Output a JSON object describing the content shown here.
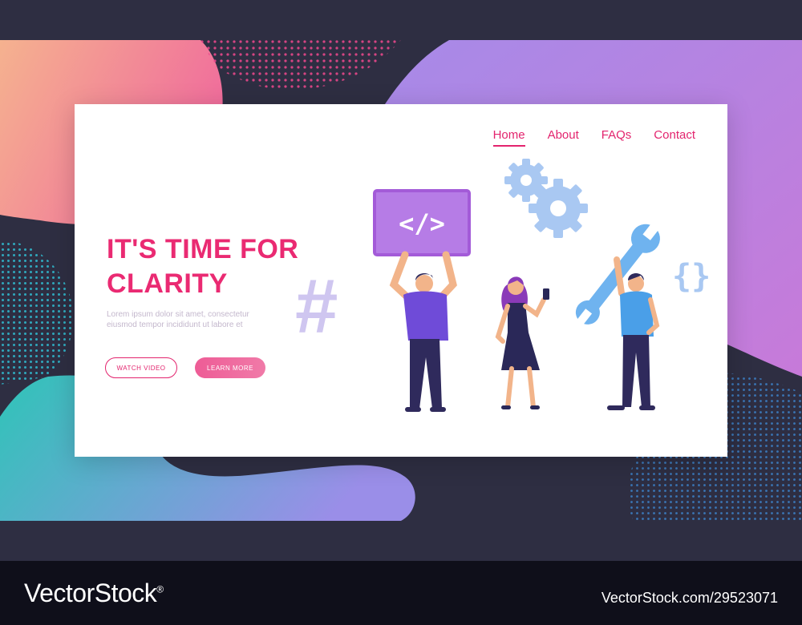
{
  "nav": {
    "items": [
      {
        "label": "Home",
        "active": true
      },
      {
        "label": "About",
        "active": false
      },
      {
        "label": "FAQs",
        "active": false
      },
      {
        "label": "Contact",
        "active": false
      }
    ]
  },
  "hero": {
    "title_line1": "IT'S TIME FOR",
    "title_line2": "CLARITY",
    "body": "Lorem ipsum dolor sit amet, consectetur eiusmod tempor incididunt ut labore et",
    "watch_video": "WATCH VIDEO",
    "learn_more": "LEARN MORE"
  },
  "illustration": {
    "sign_code": "</>",
    "hash": "#",
    "braces": "{}",
    "icons": [
      "gear-icon",
      "wrench-icon",
      "code-tag-icon",
      "hashtag-icon",
      "curly-braces-icon",
      "smartphone-icon"
    ]
  },
  "watermark": {
    "brand": "VectorStock",
    "mark": "®",
    "id": "VectorStock.com/29523071"
  },
  "colors": {
    "accent": "#e3246e",
    "title": "#ea2a72",
    "background": "#2e2e42",
    "purple": "#b67ce6",
    "teal": "#3ec4bd"
  }
}
